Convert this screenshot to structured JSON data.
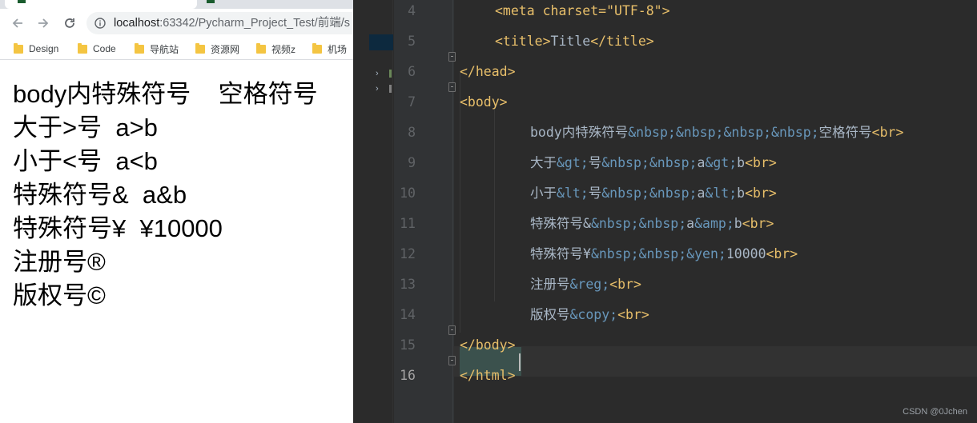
{
  "browser": {
    "nav": {
      "back_icon": "arrow-left-icon",
      "forward_icon": "arrow-right-icon",
      "reload_icon": "reload-icon",
      "info_icon": "info-icon"
    },
    "address_bar": {
      "host": "localhost",
      "rest": ":63342/Pycharm_Project_Test/前端/s"
    },
    "bookmarks": [
      "Design",
      "Code",
      "导航站",
      "资源网",
      "视频z",
      "机场"
    ],
    "content_lines": [
      "body内特殊符号    空格符号",
      "大于>号  a>b",
      "小于<号  a<b",
      "特殊符号&  a&b",
      "特殊符号¥  ¥10000",
      "注册号®",
      "版权号©"
    ]
  },
  "ide": {
    "current_line": "16",
    "lines": [
      {
        "num": "4",
        "tokens": [
          {
            "t": "tag",
            "v": "<meta charset=\"UTF-8\">"
          }
        ]
      },
      {
        "num": "5",
        "tokens": [
          {
            "t": "tag",
            "v": "<title>"
          },
          {
            "t": "text",
            "v": "Title"
          },
          {
            "t": "tag",
            "v": "</title>"
          }
        ]
      },
      {
        "num": "6",
        "tokens": [
          {
            "t": "tag",
            "v": "</head>"
          }
        ]
      },
      {
        "num": "7",
        "tokens": [
          {
            "t": "tag",
            "v": "<body>"
          }
        ]
      },
      {
        "num": "8",
        "tokens": [
          {
            "t": "text",
            "v": "body内特殊符号"
          },
          {
            "t": "ent",
            "v": "&nbsp;&nbsp;&nbsp;&nbsp;"
          },
          {
            "t": "text",
            "v": "空格符号"
          },
          {
            "t": "tag",
            "v": "<br>"
          }
        ]
      },
      {
        "num": "9",
        "tokens": [
          {
            "t": "text",
            "v": "大于"
          },
          {
            "t": "ent",
            "v": "&gt;"
          },
          {
            "t": "text",
            "v": "号"
          },
          {
            "t": "ent",
            "v": "&nbsp;&nbsp;"
          },
          {
            "t": "text",
            "v": "a"
          },
          {
            "t": "ent",
            "v": "&gt;"
          },
          {
            "t": "text",
            "v": "b"
          },
          {
            "t": "tag",
            "v": "<br>"
          }
        ]
      },
      {
        "num": "10",
        "tokens": [
          {
            "t": "text",
            "v": "小于"
          },
          {
            "t": "ent",
            "v": "&lt;"
          },
          {
            "t": "text",
            "v": "号"
          },
          {
            "t": "ent",
            "v": "&nbsp;&nbsp;"
          },
          {
            "t": "text",
            "v": "a"
          },
          {
            "t": "ent",
            "v": "&lt;"
          },
          {
            "t": "text",
            "v": "b"
          },
          {
            "t": "tag",
            "v": "<br>"
          }
        ]
      },
      {
        "num": "11",
        "tokens": [
          {
            "t": "text",
            "v": "特殊符号&"
          },
          {
            "t": "ent",
            "v": "&nbsp;&nbsp;"
          },
          {
            "t": "text",
            "v": "a"
          },
          {
            "t": "ent",
            "v": "&amp;"
          },
          {
            "t": "text",
            "v": "b"
          },
          {
            "t": "tag",
            "v": "<br>"
          }
        ]
      },
      {
        "num": "12",
        "tokens": [
          {
            "t": "text",
            "v": "特殊符号¥"
          },
          {
            "t": "ent",
            "v": "&nbsp;&nbsp;&yen;"
          },
          {
            "t": "text",
            "v": "10000"
          },
          {
            "t": "tag",
            "v": "<br>"
          }
        ]
      },
      {
        "num": "13",
        "tokens": [
          {
            "t": "text",
            "v": "注册号"
          },
          {
            "t": "ent",
            "v": "&reg;"
          },
          {
            "t": "tag",
            "v": "<br>"
          }
        ]
      },
      {
        "num": "14",
        "tokens": [
          {
            "t": "text",
            "v": "版权号"
          },
          {
            "t": "ent",
            "v": "&copy;"
          },
          {
            "t": "tag",
            "v": "<br>"
          }
        ]
      },
      {
        "num": "15",
        "tokens": [
          {
            "t": "tag",
            "v": "</body>"
          }
        ]
      },
      {
        "num": "16",
        "tokens": [
          {
            "t": "tag",
            "v": "</html>"
          }
        ]
      }
    ]
  },
  "watermark": "CSDN @0Jchen",
  "colors": {
    "tag": "#e8bf6a",
    "text": "#a9b7c6",
    "entity": "#6897bb",
    "editor_bg": "#2b2b2b",
    "gutter_bg": "#313335"
  }
}
